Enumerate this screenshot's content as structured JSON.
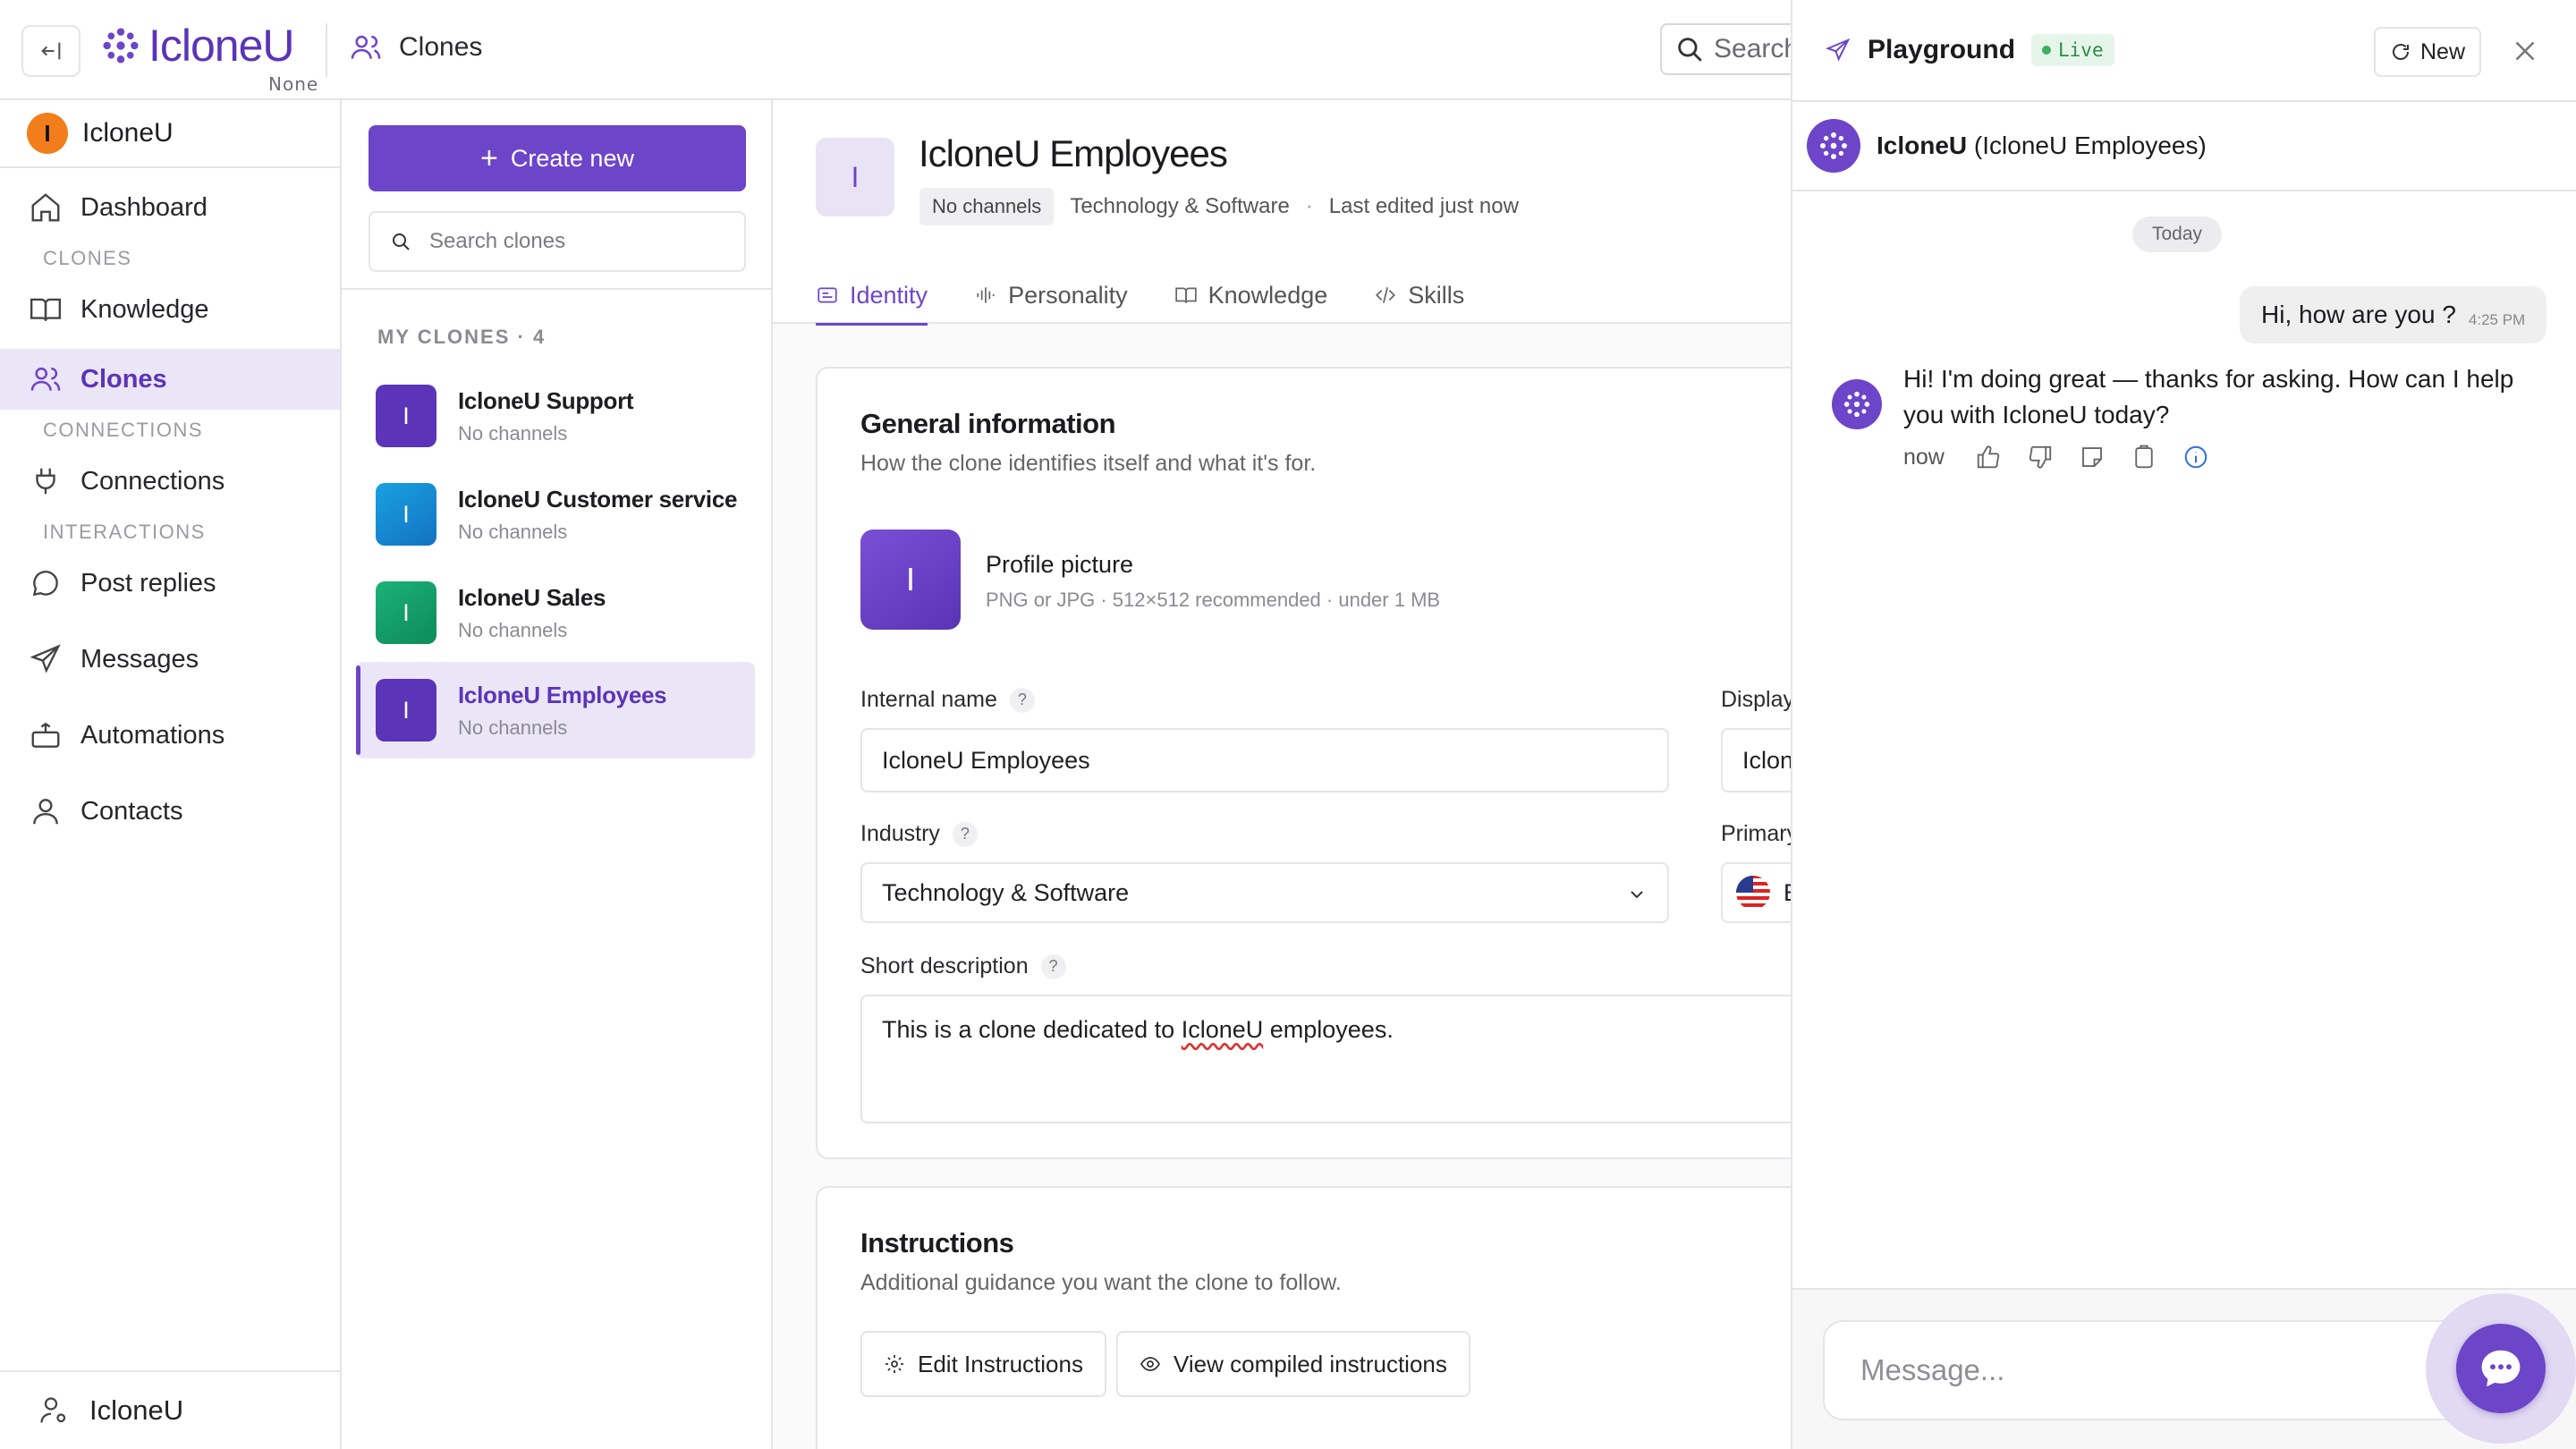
{
  "topbar": {
    "brand_name": "IcloneU",
    "brand_sub": "None",
    "page_title": "Clones",
    "search_label": "Search"
  },
  "nav": {
    "org_initial": "I",
    "org_name": "IcloneU",
    "dashboard": "Dashboard",
    "section_clones": "CLONES",
    "knowledge": "Knowledge",
    "clones": "Clones",
    "section_connections": "CONNECTIONS",
    "connections": "Connections",
    "section_interactions": "INTERACTIONS",
    "post_replies": "Post replies",
    "messages": "Messages",
    "automations": "Automations",
    "contacts": "Contacts",
    "footer_user": "IcloneU"
  },
  "clones_panel": {
    "create_label": "Create new",
    "search_placeholder": "Search clones",
    "heading": "MY CLONES · 4",
    "items": [
      {
        "initial": "I",
        "name": "IcloneU Support",
        "sub": "No channels",
        "color": "#5b34b8"
      },
      {
        "initial": "I",
        "name": "IcloneU Customer service",
        "sub": "No channels",
        "color": "#1c8fd6"
      },
      {
        "initial": "I",
        "name": "IcloneU Sales",
        "sub": "No channels",
        "color": "#14a06a"
      },
      {
        "initial": "I",
        "name": "IcloneU Employees",
        "sub": "No channels",
        "color": "#5b34b8"
      }
    ]
  },
  "main": {
    "initial": "I",
    "title": "IcloneU Employees",
    "chip": "No channels",
    "industry_meta": "Technology & Software",
    "sep": "·",
    "edited": "Last edited just now",
    "tabs": [
      "Identity",
      "Personality",
      "Knowledge",
      "Skills"
    ],
    "general": {
      "title": "General information",
      "subtitle": "How the clone identifies itself and what it's for.",
      "pic_initial": "I",
      "pic_title": "Profile picture",
      "pic_sub": "PNG or JPG · 512×512 recommended · under 1 MB",
      "internal_label": "Internal name",
      "internal_value": "IcloneU Employees",
      "display_label": "Display na",
      "display_value": "IcloneU",
      "industry_label": "Industry",
      "industry_value": "Technology & Software",
      "language_label": "Primary lar",
      "language_value": "Eng",
      "desc_label": "Short description",
      "desc_before": "This is a clone dedicated to ",
      "desc_misspelled": "IcloneU",
      "desc_after": " employees.",
      "help": "?"
    },
    "instructions": {
      "title": "Instructions",
      "subtitle": "Additional guidance you want the clone to follow.",
      "edit_label": "Edit Instructions",
      "view_label": "View compiled instructions"
    }
  },
  "playground": {
    "title": "Playground",
    "live": "Live",
    "new_label": "New",
    "bot_name_bold": "IcloneU",
    "bot_name_rest": " (IcloneU Employees)",
    "today": "Today",
    "user_msg": "Hi, how are you ?",
    "user_time": "4:25 PM",
    "bot_msg": "Hi! I'm doing great — thanks for asking. How can I help you with IcloneU today?",
    "bot_time": "now",
    "input_placeholder": "Message..."
  },
  "colors": {
    "accent": "#6d45c9",
    "live": "#2e8b48"
  }
}
